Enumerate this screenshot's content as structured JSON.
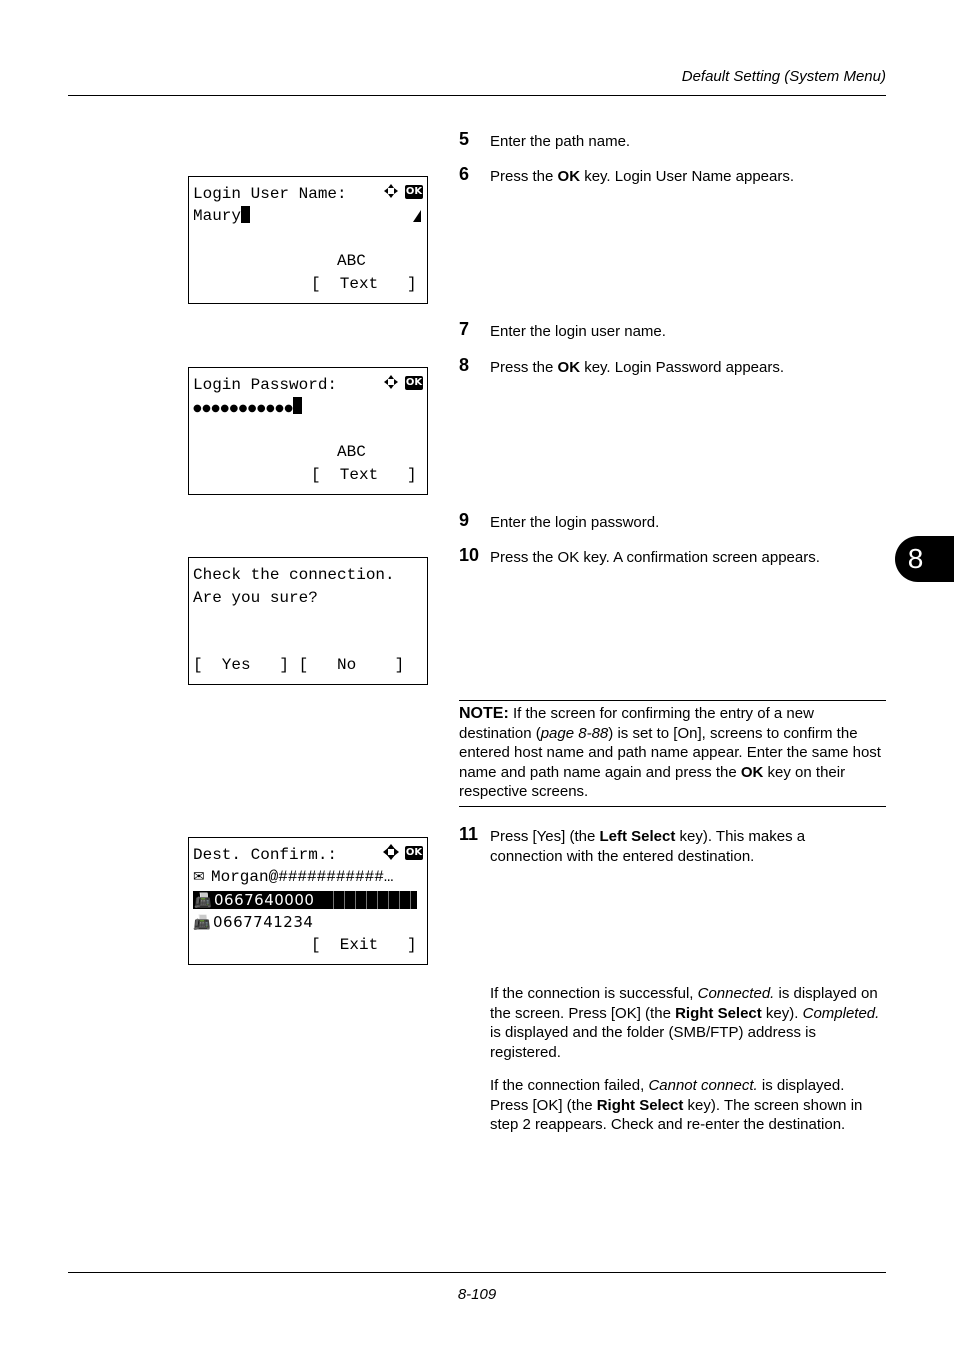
{
  "header": {
    "title": "Default Setting (System Menu)"
  },
  "footer": {
    "page_number": "8-109"
  },
  "chapter_tab": {
    "label": "8"
  },
  "steps": [
    {
      "num": "5",
      "parts": [
        {
          "t": "Enter the path name."
        }
      ]
    },
    {
      "num": "6",
      "parts": [
        {
          "t": "Press the "
        },
        {
          "t": "OK",
          "b": true
        },
        {
          "t": " key. Login User Name appears."
        }
      ]
    },
    {
      "num": "7",
      "parts": [
        {
          "t": "Enter the login user name."
        }
      ]
    },
    {
      "num": "8",
      "parts": [
        {
          "t": "Press the "
        },
        {
          "t": "OK",
          "b": true
        },
        {
          "t": " key. Login Password appears."
        }
      ]
    },
    {
      "num": "9",
      "parts": [
        {
          "t": "Enter the login password."
        }
      ]
    },
    {
      "num": "10",
      "parts": [
        {
          "t": "Press the OK key. A confirmation screen appears."
        }
      ]
    },
    {
      "num": "11",
      "parts": [
        {
          "t": "Press [Yes] (the "
        },
        {
          "t": "Left Select",
          "b": true
        },
        {
          "t": " key). This makes a connection with the entered destination."
        }
      ]
    }
  ],
  "note": {
    "label": "NOTE:",
    "parts": [
      {
        "t": " If the screen for confirming the entry of a new destination ("
      },
      {
        "t": "page 8-88",
        "i": true
      },
      {
        "t": ") is set to [On], screens to confirm the entered host name and path name appear. Enter the same host name and path name again and press the "
      },
      {
        "t": "OK",
        "b": true
      },
      {
        "t": " key on their respective screens."
      }
    ]
  },
  "paragraphs": [
    {
      "parts": [
        {
          "t": "If the connection is successful, "
        },
        {
          "t": "Connected.",
          "i": true
        },
        {
          "t": " is displayed on the screen. Press [OK] (the "
        },
        {
          "t": "Right Select",
          "b": true
        },
        {
          "t": " key). "
        },
        {
          "t": "Completed.",
          "i": true
        },
        {
          "t": " is displayed and the folder (SMB/FTP) address is registered."
        }
      ]
    },
    {
      "parts": [
        {
          "t": "If the connection failed, "
        },
        {
          "t": "Cannot connect.",
          "i": true
        },
        {
          "t": " is displayed. Press [OK] (the "
        },
        {
          "t": "Right Select",
          "b": true
        },
        {
          "t": " key). The screen shown in step 2 reappears. Check and re-enter the destination."
        }
      ]
    }
  ],
  "screens": {
    "login_user": {
      "title": "Login User Name:",
      "value": "Maury",
      "mode": "ABC",
      "softkey": "[  Text   ]",
      "ok_label": "OK"
    },
    "login_password": {
      "title": "Login Password:",
      "value": "●●●●●●●●●●●",
      "mode": "ABC",
      "softkey": "[  Text   ]",
      "ok_label": "OK"
    },
    "confirm": {
      "line1": "Check the connection.",
      "line2": "Are you sure?",
      "softkeys": "[  Yes   ] [   No    ]"
    },
    "dest_confirm": {
      "title": "Dest. Confirm.:",
      "email": "Morgan@###########…",
      "fax1": "0667640000",
      "fax2": "0667741234",
      "softkey": "[  Exit   ]",
      "ok_label": "OK",
      "mail_icon": "✉",
      "fax_icon": "📠"
    }
  }
}
